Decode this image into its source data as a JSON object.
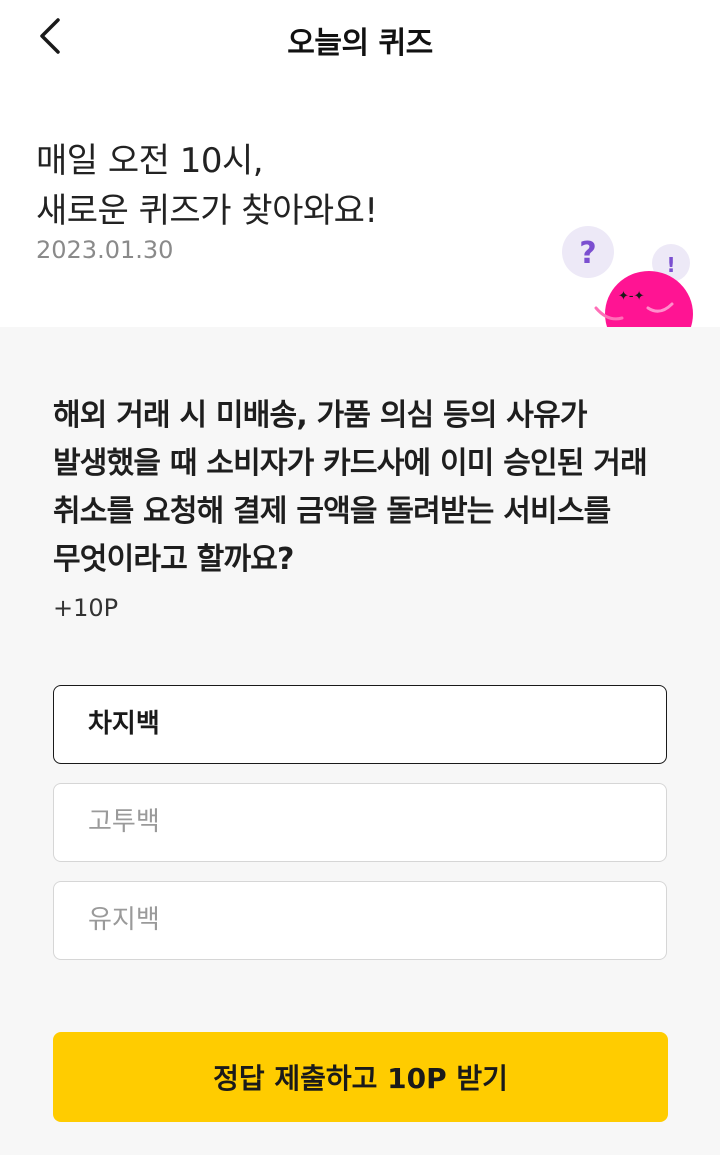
{
  "header": {
    "title": "오늘의 퀴즈",
    "back_icon": "chevron-left-icon"
  },
  "intro": {
    "headline_line1": "매일 오전 10시,",
    "headline_line2": "새로운 퀴즈가 찾아와요!",
    "date": "2023.01.30",
    "mascot_question_mark": "?",
    "mascot_exclamation_mark": "!"
  },
  "quiz": {
    "question": "해외 거래 시 미배송, 가품 의심 등의 사유가 발생했을 때 소비자가 카드사에 이미 승인된 거래 취소를 요청해 결제 금액을 돌려받는 서비스를 무엇이라고 할까요?",
    "points": "+10P",
    "options": [
      {
        "label": "차지백",
        "selected": true
      },
      {
        "label": "고투백",
        "selected": false
      },
      {
        "label": "유지백",
        "selected": false
      }
    ]
  },
  "submit": {
    "label": "정답 제출하고 10P 받기"
  },
  "colors": {
    "accent": "#ffcc00",
    "mascot": "#ff1493",
    "bubble": "#ede9f7",
    "bubble_mark": "#7b4fd0"
  }
}
